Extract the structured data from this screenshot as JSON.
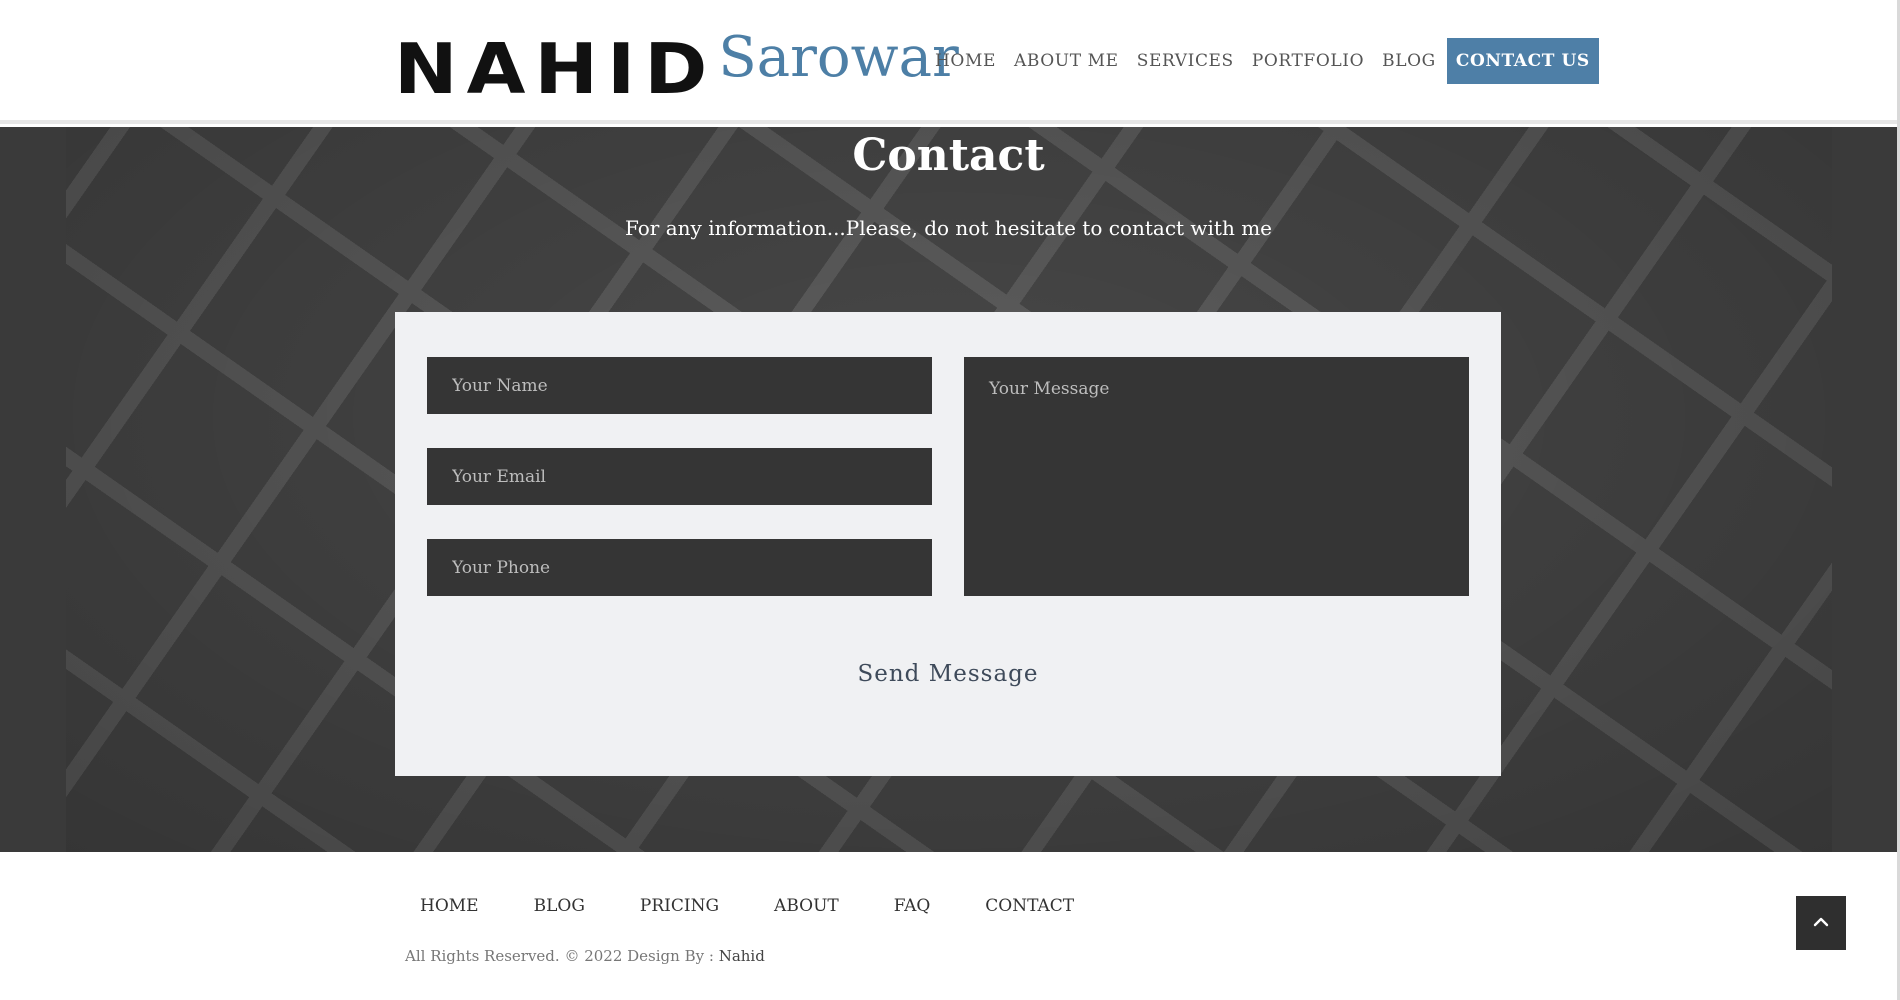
{
  "brand": {
    "name_main": "NAHID",
    "name_sub": "Sarowar"
  },
  "nav": {
    "items": [
      {
        "label": "HOME"
      },
      {
        "label": "ABOUT ME"
      },
      {
        "label": "SERVICES"
      },
      {
        "label": "PORTFOLIO"
      },
      {
        "label": "BLOG"
      },
      {
        "label": "CONTACT US",
        "active": true
      }
    ]
  },
  "contact": {
    "title": "Contact",
    "subtitle": "For any information...Please, do not hesitate to contact with me",
    "form": {
      "name_placeholder": "Your Name",
      "email_placeholder": "Your Email",
      "phone_placeholder": "Your Phone",
      "message_placeholder": "Your Message",
      "submit_label": "Send Message"
    }
  },
  "footer": {
    "links": [
      {
        "label": "HOME"
      },
      {
        "label": "BLOG"
      },
      {
        "label": "PRICING"
      },
      {
        "label": "ABOUT"
      },
      {
        "label": "FAQ"
      },
      {
        "label": "CONTACT"
      }
    ],
    "copyright": "All Rights Reserved. © 2022 Design By : ",
    "designer": "Nahid"
  },
  "icons": {
    "back_to_top": "chevron-up-icon"
  },
  "colors": {
    "accent": "#4e7fa7",
    "form_field_bg": "#353535",
    "form_card_bg": "#f0f1f3",
    "section_bg": "#3a3a3a"
  }
}
